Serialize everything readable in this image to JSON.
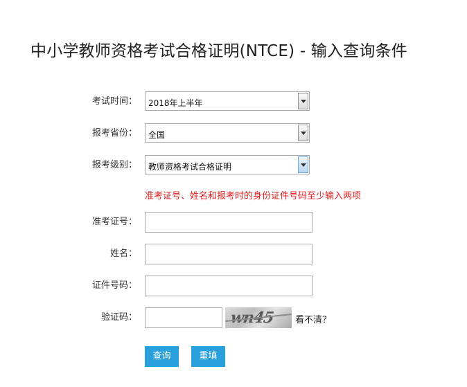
{
  "page": {
    "title": "中小学教师资格考试合格证明(NTCE) - 输入查询条件"
  },
  "form": {
    "exam_time": {
      "label": "考试时间：",
      "value": "2018年上半年"
    },
    "province": {
      "label": "报考省份：",
      "value": "全国"
    },
    "level": {
      "label": "报考级别：",
      "value": "教师资格考试合格证明"
    },
    "hint": "准考证号、姓名和报考时的身份证件号码至少输入两项",
    "ticket_number": {
      "label": "准考证号：",
      "value": "",
      "placeholder": ""
    },
    "name": {
      "label": "姓名：",
      "value": "",
      "placeholder": ""
    },
    "id_number": {
      "label": "证件号码：",
      "value": "",
      "placeholder": ""
    },
    "captcha": {
      "label": "验证码：",
      "value": "",
      "image_text": "wn45",
      "refresh_label": "看不清？"
    }
  },
  "actions": {
    "query_label": "查询",
    "reset_label": "重填"
  },
  "colors": {
    "accent": "#29a0dc",
    "hint": "#e02020"
  }
}
